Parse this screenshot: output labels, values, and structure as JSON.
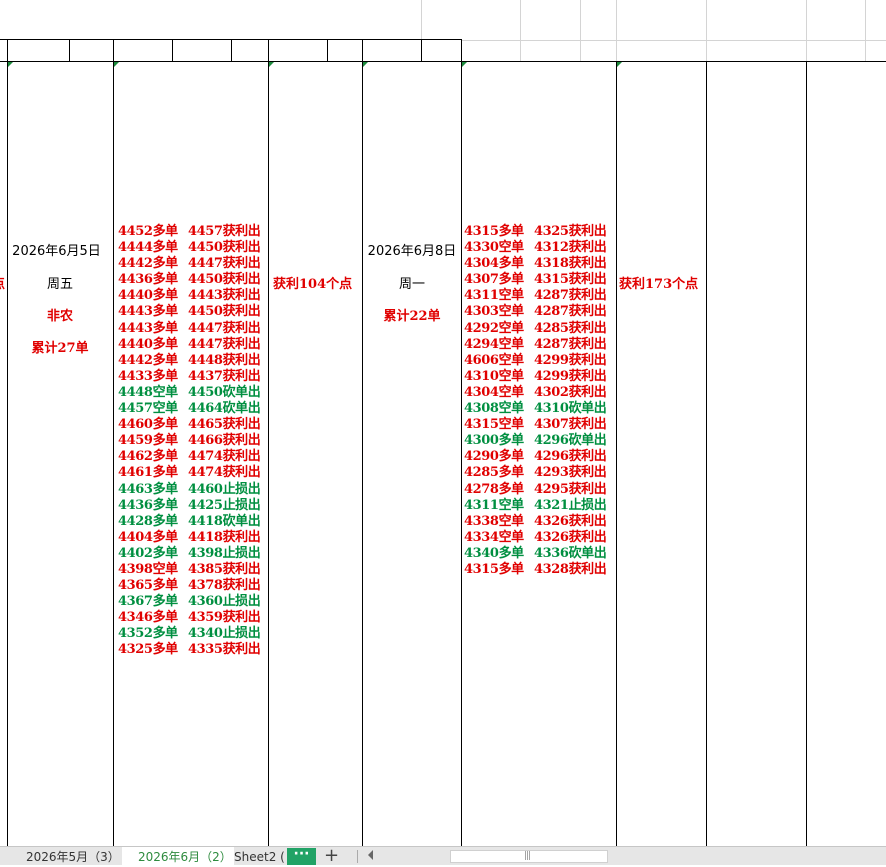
{
  "colors": {
    "profit_red": "#e00000",
    "green": "#008f40",
    "tab_active_text": "#2e8b3e",
    "more_button": "#21a366"
  },
  "left_partial_char": "点",
  "day1": {
    "date": "2026年6月5日",
    "weekday": "周五",
    "note": "非农",
    "cumulative": "累计27单",
    "summary": "获利104个点"
  },
  "day2": {
    "date": "2026年6月8日",
    "weekday": "周一",
    "cumulative": "累计22单",
    "summary": "获利173个点"
  },
  "trades_day1": [
    {
      "open": "4452多单",
      "close": "4457获利出",
      "color": "red"
    },
    {
      "open": "4444多单",
      "close": "4450获利出",
      "color": "red"
    },
    {
      "open": "4442多单",
      "close": "4447获利出",
      "color": "red"
    },
    {
      "open": "4436多单",
      "close": "4450获利出",
      "color": "red"
    },
    {
      "open": "4440多单",
      "close": "4443获利出",
      "color": "red"
    },
    {
      "open": "4443多单",
      "close": "4450获利出",
      "color": "red"
    },
    {
      "open": "4443多单",
      "close": "4447获利出",
      "color": "red"
    },
    {
      "open": "4440多单",
      "close": "4447获利出",
      "color": "red"
    },
    {
      "open": "4442多单",
      "close": "4448获利出",
      "color": "red"
    },
    {
      "open": "4433多单",
      "close": "4437获利出",
      "color": "red"
    },
    {
      "open": "4448空单",
      "close": "4450砍单出",
      "color": "green"
    },
    {
      "open": "4457空单",
      "close": "4464砍单出",
      "color": "green"
    },
    {
      "open": "4460多单",
      "close": "4465获利出",
      "color": "red"
    },
    {
      "open": "4459多单",
      "close": "4466获利出",
      "color": "red"
    },
    {
      "open": "4462多单",
      "close": "4474获利出",
      "color": "red"
    },
    {
      "open": "4461多单",
      "close": "4474获利出",
      "color": "red"
    },
    {
      "open": "4463多单",
      "close": "4460止损出",
      "color": "green"
    },
    {
      "open": "4436多单",
      "close": "4425止损出",
      "color": "green"
    },
    {
      "open": "4428多单",
      "close": "4418砍单出",
      "color": "green"
    },
    {
      "open": "4404多单",
      "close": "4418获利出",
      "color": "red"
    },
    {
      "open": "4402多单",
      "close": "4398止损出",
      "color": "green"
    },
    {
      "open": "4398空单",
      "close": "4385获利出",
      "color": "red"
    },
    {
      "open": "4365多单",
      "close": "4378获利出",
      "color": "red"
    },
    {
      "open": "4367多单",
      "close": "4360止损出",
      "color": "green"
    },
    {
      "open": "4346多单",
      "close": "4359获利出",
      "color": "red"
    },
    {
      "open": "4352多单",
      "close": "4340止损出",
      "color": "green"
    },
    {
      "open": "4325多单",
      "close": "4335获利出",
      "color": "red"
    }
  ],
  "trades_day2": [
    {
      "open": "4315多单",
      "close": "4325获利出",
      "color": "red"
    },
    {
      "open": "4330空单",
      "close": "4312获利出",
      "color": "red"
    },
    {
      "open": "4304多单",
      "close": "4318获利出",
      "color": "red"
    },
    {
      "open": "4307多单",
      "close": "4315获利出",
      "color": "red"
    },
    {
      "open": "4311空单",
      "close": "4287获利出",
      "color": "red"
    },
    {
      "open": "4303空单",
      "close": "4287获利出",
      "color": "red"
    },
    {
      "open": "4292空单",
      "close": "4285获利出",
      "color": "red"
    },
    {
      "open": "4294空单",
      "close": "4287获利出",
      "color": "red"
    },
    {
      "open": "4606空单",
      "close": "4299获利出",
      "color": "red"
    },
    {
      "open": "4310空单",
      "close": "4299获利出",
      "color": "red"
    },
    {
      "open": "4304空单",
      "close": "4302获利出",
      "color": "red"
    },
    {
      "open": "4308空单",
      "close": "4310砍单出",
      "color": "green"
    },
    {
      "open": "4315空单",
      "close": "4307获利出",
      "color": "red"
    },
    {
      "open": "4300多单",
      "close": "4296砍单出",
      "color": "green"
    },
    {
      "open": "4290多单",
      "close": "4296获利出",
      "color": "red"
    },
    {
      "open": "4285多单",
      "close": "4293获利出",
      "color": "red"
    },
    {
      "open": "4278多单",
      "close": "4295获利出",
      "color": "red"
    },
    {
      "open": "4311空单",
      "close": "4321止损出",
      "color": "green"
    },
    {
      "open": "4338空单",
      "close": "4326获利出",
      "color": "red"
    },
    {
      "open": "4334空单",
      "close": "4326获利出",
      "color": "red"
    },
    {
      "open": "4340多单",
      "close": "4336砍单出",
      "color": "green"
    },
    {
      "open": "4315多单",
      "close": "4328获利出",
      "color": "red"
    }
  ],
  "tabs": [
    {
      "label": "2026年5月（3）",
      "active": false
    },
    {
      "label": "2026年6月（2）",
      "active": true
    },
    {
      "label": "Sheet2 (",
      "active": false
    }
  ],
  "tab_controls": {
    "more_label": "···",
    "add_label": "+",
    "scroll_grip": "|||"
  }
}
